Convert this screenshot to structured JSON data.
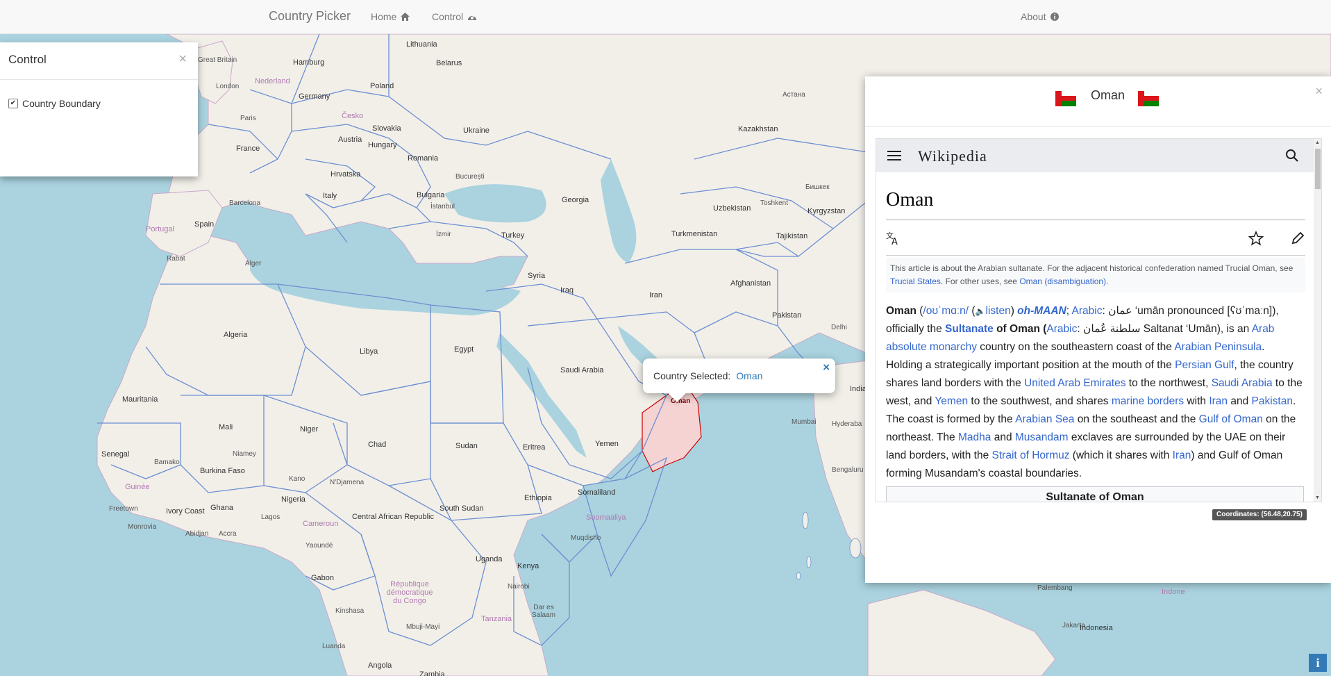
{
  "navbar": {
    "brand": "Country Picker",
    "home_label": "Home",
    "control_label": "Control",
    "about_label": "About"
  },
  "control_panel": {
    "title": "Control",
    "close": "×",
    "checkbox_label": "Country Boundary",
    "checkbox_checked": true
  },
  "popup": {
    "prefix": "Country Selected:",
    "country": "Oman",
    "close": "×"
  },
  "info_panel": {
    "title": "Oman",
    "close": "×",
    "flag_icon": "oman-flag-icon",
    "wikipedia": {
      "logo": "Wikipedia",
      "heading": "Oman",
      "hatnote": {
        "text1": "This article is about the Arabian sultanate. For the adjacent historical confederation named Trucial Oman, see ",
        "link1": "Trucial States",
        "text2": ". For other uses, see ",
        "link2": "Oman (disambiguation)",
        "text3": "."
      },
      "intro": {
        "p1": "Oman",
        "p2": " (",
        "ipa": "/oʊˈmɑːn/",
        "p3": " (",
        "listen": "listen",
        "p4": ") ",
        "respell": "oh-MAAN",
        "p5": "; ",
        "arabic": "Arabic",
        "p6": ": عمان ‘umān pronounced [ʕʊˈmaːn]), officially the ",
        "sultanate": "Sultanate",
        "p7": " of Oman (",
        "arabic2": "Arabic",
        "p8": ": سلطنة عُمان Saltanat ‘Umān), is an ",
        "link_arab": "Arab",
        "p9": " ",
        "link_monarchy": "absolute monarchy",
        "p10": " country on the southeastern coast of the ",
        "link_peninsula": "Arabian Peninsula",
        "p11": ". Holding a strategically important position at the mouth of the ",
        "link_gulf": "Persian Gulf",
        "p12": ", the country shares land borders with the ",
        "link_uae": "United Arab Emirates",
        "p13": " to the northwest, ",
        "link_saudi": "Saudi Arabia",
        "p14": " to the west, and ",
        "link_yemen": "Yemen",
        "p15": " to the southwest, and shares ",
        "link_marine": "marine borders",
        "p16": " with ",
        "link_iran": "Iran",
        "p17": " and ",
        "link_pakistan": "Pakistan",
        "p18": ". The coast is formed by the ",
        "link_arabian_sea": "Arabian Sea",
        "p19": " on the southeast and the ",
        "link_gulf_oman": "Gulf of Oman",
        "p20": " on the northeast. The ",
        "link_madha": "Madha",
        "p21": " and ",
        "link_musandam": "Musandam",
        "p22": " exclaves are surrounded by the UAE on their land borders, with the ",
        "link_hormuz": "Strait of Hormuz",
        "p23": " (which it shares with ",
        "link_iran2": "Iran",
        "p24": ") and Gulf of Oman forming Musandam's coastal boundaries."
      },
      "infobox_title": "Sultanate of Oman"
    }
  },
  "coordinates": "Coordinates:  (56.48,20.75)",
  "map": {
    "selected_label": "Oman",
    "labels": {
      "lithuania": "Lithuania",
      "hamburg": "Hamburg",
      "belarus": "Belarus",
      "nederland": "Nederland",
      "london": "London",
      "poland": "Poland",
      "germany": "Germany",
      "paris": "Paris",
      "france": "France",
      "cesko": "Česko",
      "slovakia": "Slovakia",
      "ukraine": "Ukraine",
      "austria": "Austria",
      "hungary": "Hungary",
      "romania": "Romania",
      "bucuresti": "București",
      "hrvatska": "Hrvatska",
      "italy": "Italy",
      "barcelona": "Barcelona",
      "spain": "Spain",
      "bulgaria": "Bulgaria",
      "istanbul": "İstanbul",
      "georgia": "Georgia",
      "turkey": "Turkey",
      "izmir": "İzmir",
      "kazakhstan": "Kazakhstan",
      "uzbekistan": "Uzbekistan",
      "toshkent": "Toshkent",
      "kyrgyzstan": "Kyrgyzstan",
      "turkmenistan": "Turkmenistan",
      "tajikistan": "Tajikistan",
      "afghanistan": "Afghanistan",
      "pakistan": "Pakistan",
      "delhi": "Delhi",
      "india": "India",
      "mumbai": "Mumbai",
      "hyderabad": "Hyderaba",
      "bengaluru": "Bengaluru",
      "iran": "Iran",
      "iraq": "Iraq",
      "syria": "Syria",
      "egypt": "Egypt",
      "libya": "Libya",
      "algeria": "Algeria",
      "alger": "Alger",
      "rabat": "Rabat",
      "saudi_arabia": "Saudi Arabia",
      "yemen": "Yemen",
      "eritrea": "Eritrea",
      "sudan": "Sudan",
      "chad": "Chad",
      "niger": "Niger",
      "mali": "Mali",
      "mauritania": "Mauritania",
      "senegal": "Senegal",
      "bamako": "Bamako",
      "burkina_faso": "Burkina Faso",
      "niamey": "Niamey",
      "nigeria": "Nigeria",
      "kano": "Kano",
      "ndjamena": "N'Djamena",
      "guinee": "Guinée",
      "freetown": "Freetown",
      "monrovia": "Monrovia",
      "ivory_coast": "Ivory Coast",
      "ghana": "Ghana",
      "abidjan": "Abidjan",
      "accra": "Accra",
      "lagos": "Lagos",
      "cameroun": "Cameroun",
      "yaounde": "Yaoundé",
      "gabon": "Gabon",
      "car": "Central African Republic",
      "south_sudan": "South Sudan",
      "ethiopia": "Ethiopia",
      "somaliland": "Somaliland",
      "somaalia": "Soomaaliya",
      "muqdisho": "Muqdisho",
      "uganda": "Uganda",
      "kenya": "Kenya",
      "nairobi": "Nairobi",
      "kinshasa": "Kinshasa",
      "rdc": "République démocratique du Congo",
      "tanzania": "Tanzania",
      "dar": "Dar es Salaam",
      "mayi": "Mbuji-Mayi",
      "luanda": "Luanda",
      "angola": "Angola",
      "zambia": "Zambia",
      "palembang": "Palembang",
      "jakarta": "Jakarta",
      "indonesia": "Indonesia",
      "indone": "Indone",
      "astana": "Астана",
      "bishkek": "Бишкек",
      "portugal": "Portugal",
      "great_britain": "Great Britain"
    }
  },
  "colors": {
    "water": "#aad3df",
    "land": "#f2efe9",
    "boundary": "#6b8fd1",
    "selected_fill": "#f6d3d3",
    "selected_stroke": "#cc0000",
    "link": "#3366cc",
    "oman_red": "#db161b",
    "oman_green": "#008000"
  }
}
